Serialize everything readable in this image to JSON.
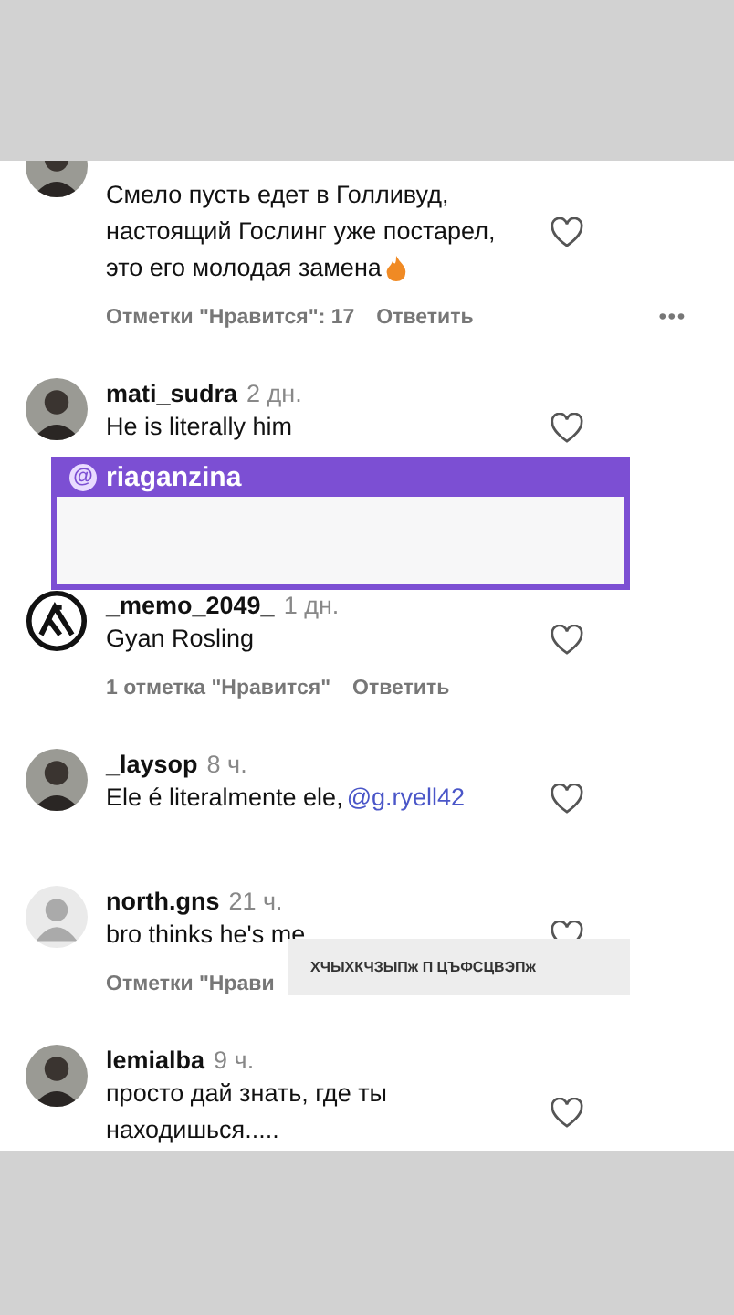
{
  "comments": [
    {
      "avatar": {
        "kind": "photo"
      },
      "lines": [
        "Смело пусть едет в Голливуд,",
        "настоящий Гослинг уже постарел,",
        "это его молодая замена"
      ],
      "fire": true,
      "likes": "Отметки \"Нравится\": 17",
      "reply": "Ответить",
      "more": "•••"
    },
    {
      "avatar": {
        "kind": "photo"
      },
      "user": "mati_sudra",
      "time": "2 дн.",
      "lines": [
        "He is literally him"
      ]
    },
    {
      "kind": "credit",
      "icon": "@",
      "handle": "riaganzina"
    },
    {
      "avatar": {
        "kind": "logo"
      },
      "user": "_memo_2049_",
      "time": "1 дн.",
      "lines": [
        "Gyan Rosling"
      ],
      "likes": "1 отметка \"Нравится\"",
      "reply": "Ответить"
    },
    {
      "avatar": {
        "kind": "photo"
      },
      "user": "_laysop",
      "time": "8 ч.",
      "lines": [
        "Ele é literalmente ele,"
      ],
      "mention": "@g.ryell42"
    },
    {
      "avatar": {
        "kind": "default"
      },
      "user": "north.gns",
      "time": "21 ч.",
      "lines": [
        "bro thinks he's me"
      ],
      "likes": "Отметки \"Нрави",
      "caption": "ХЧЫХКЧЗЫПж П ЦЪФСЦВЭПж"
    },
    {
      "avatar": {
        "kind": "photo"
      },
      "user": "lemialba",
      "time": "9 ч.",
      "lines": [
        "просто дай знать, где ты",
        "находишься....."
      ]
    }
  ]
}
